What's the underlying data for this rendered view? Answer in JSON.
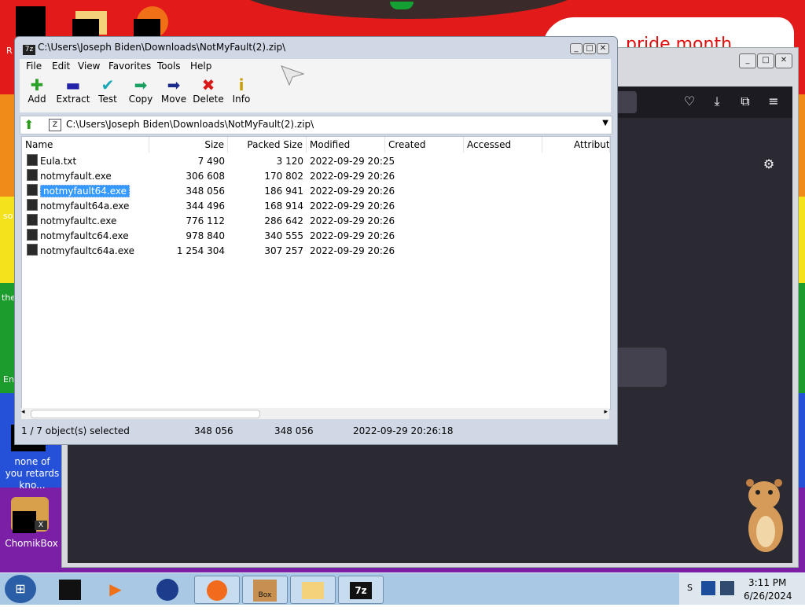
{
  "desktop": {
    "banner_text": "pride month",
    "icons": {
      "none_of_you": "none of you retards kno...",
      "chomikbox": "ChomikBox",
      "chomikbox_badge": "X"
    },
    "edge_fragments": [
      "R",
      "so",
      "the",
      "En"
    ]
  },
  "zip_window": {
    "title": "C:\\Users\\Joseph Biden\\Downloads\\NotMyFault(2).zip\\",
    "app_badge": "7z",
    "menu": [
      "File",
      "Edit",
      "View",
      "Favorites",
      "Tools",
      "Help"
    ],
    "toolbar": [
      "Add",
      "Extract",
      "Test",
      "Copy",
      "Move",
      "Delete",
      "Info"
    ],
    "address": "C:\\Users\\Joseph Biden\\Downloads\\NotMyFault(2).zip\\",
    "columns": [
      "Name",
      "Size",
      "Packed Size",
      "Modified",
      "Created",
      "Accessed",
      "Attributes"
    ],
    "rows": [
      {
        "name": "Eula.txt",
        "size": "7 490",
        "packed": "3 120",
        "modified": "2022-09-29 20:25"
      },
      {
        "name": "notmyfault.exe",
        "size": "306 608",
        "packed": "170 802",
        "modified": "2022-09-29 20:26"
      },
      {
        "name": "notmyfault64.exe",
        "size": "348 056",
        "packed": "186 941",
        "modified": "2022-09-29 20:26",
        "selected": true
      },
      {
        "name": "notmyfault64a.exe",
        "size": "344 496",
        "packed": "168 914",
        "modified": "2022-09-29 20:26"
      },
      {
        "name": "notmyfaultc.exe",
        "size": "776 112",
        "packed": "286 642",
        "modified": "2022-09-29 20:26"
      },
      {
        "name": "notmyfaultc64.exe",
        "size": "978 840",
        "packed": "340 555",
        "modified": "2022-09-29 20:26"
      },
      {
        "name": "notmyfaultc64a.exe",
        "size": "1 254 304",
        "packed": "307 257",
        "modified": "2022-09-29 20:26"
      }
    ],
    "status": {
      "selection": "1 / 7 object(s) selected",
      "size": "348 056",
      "packed": "348 056",
      "modified": "2022-09-29 20:26:18"
    }
  },
  "taskbar": {
    "clock_time": "3:11 PM",
    "clock_date": "6/26/2024",
    "sevenzip_label": "7z",
    "chomik_label": "Box",
    "tray_fragment": "S"
  }
}
